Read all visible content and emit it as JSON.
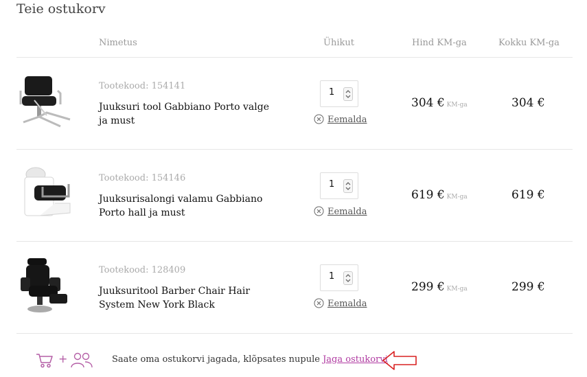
{
  "page": {
    "title": "Teie ostukorv"
  },
  "table": {
    "headers": {
      "name": "Nimetus",
      "qty": "Ühikut",
      "price": "Hind KM-ga",
      "total": "Kokku KM-ga"
    },
    "items": [
      {
        "code": "Tootekood: 154141",
        "name": "Juuksuri tool Gabbiano Porto valge ja must",
        "qty": "1",
        "remove": "Eemalda",
        "price": "304 €",
        "price_suffix": "KM-ga",
        "total": "304 €",
        "image": "styling-chair-white-black"
      },
      {
        "code": "Tootekood: 154146",
        "name": "Juuksurisalongi valamu Gabbiano Porto hall ja must",
        "qty": "1",
        "remove": "Eemalda",
        "price": "619 €",
        "price_suffix": "KM-ga",
        "total": "619 €",
        "image": "wash-unit-grey-black"
      },
      {
        "code": "Tootekood: 128409",
        "name": "Juuksuritool Barber Chair Hair System New York Black",
        "qty": "1",
        "remove": "Eemalda",
        "price": "299 €",
        "price_suffix": "KM-ga",
        "total": "299 €",
        "image": "barber-chair-black"
      }
    ]
  },
  "share": {
    "text": "Saate oma ostukorvi jagada, klõpsates nupule",
    "link": "Jaga ostukorvi",
    "plus": "+",
    "icons": [
      "cart-icon",
      "people-icon",
      "arrow-left-icon"
    ],
    "accent_color": "#b03aa1",
    "arrow_color": "#d92020"
  }
}
